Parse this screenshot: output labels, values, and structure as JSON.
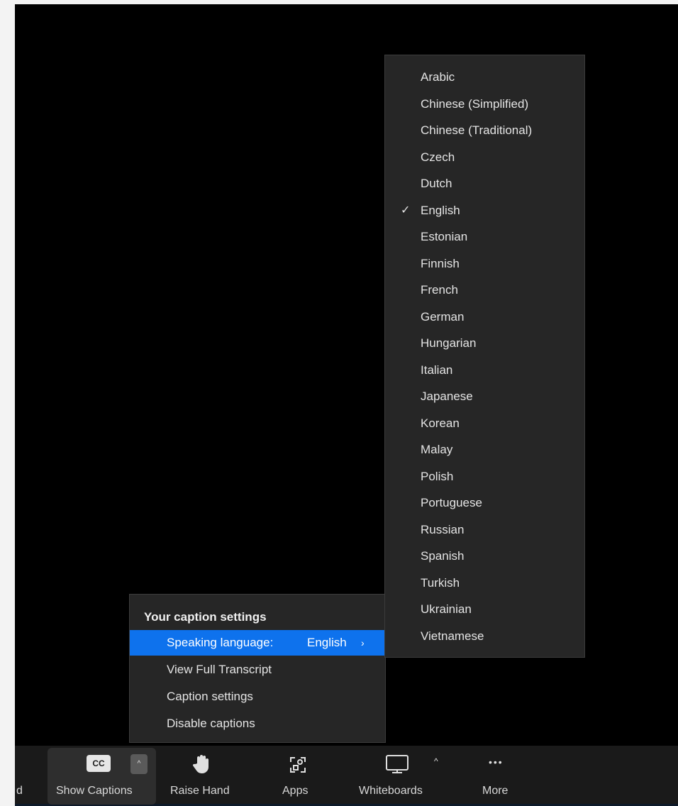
{
  "caption_menu": {
    "heading": "Your caption settings",
    "speaking_language_label": "Speaking language:",
    "speaking_language_value": "English",
    "chevron": "›",
    "items": [
      "View Full Transcript",
      "Caption settings",
      "Disable captions"
    ]
  },
  "language_menu": {
    "selected": "English",
    "check_glyph": "✓",
    "languages": [
      "Arabic",
      "Chinese (Simplified)",
      "Chinese (Traditional)",
      "Czech",
      "Dutch",
      "English",
      "Estonian",
      "Finnish",
      "French",
      "German",
      "Hungarian",
      "Italian",
      "Japanese",
      "Korean",
      "Malay",
      "Polish",
      "Portuguese",
      "Russian",
      "Spanish",
      "Turkish",
      "Ukrainian",
      "Vietnamese"
    ]
  },
  "toolbar": {
    "edge_label": "d",
    "cc_text": "CC",
    "caret_glyph": "^",
    "show_captions": "Show Captions",
    "raise_hand": "Raise Hand",
    "apps": "Apps",
    "whiteboards": "Whiteboards",
    "more": "More",
    "more_glyph": "•••",
    "whiteboard_caret": "^",
    "accent_color": "#0e72ed"
  }
}
